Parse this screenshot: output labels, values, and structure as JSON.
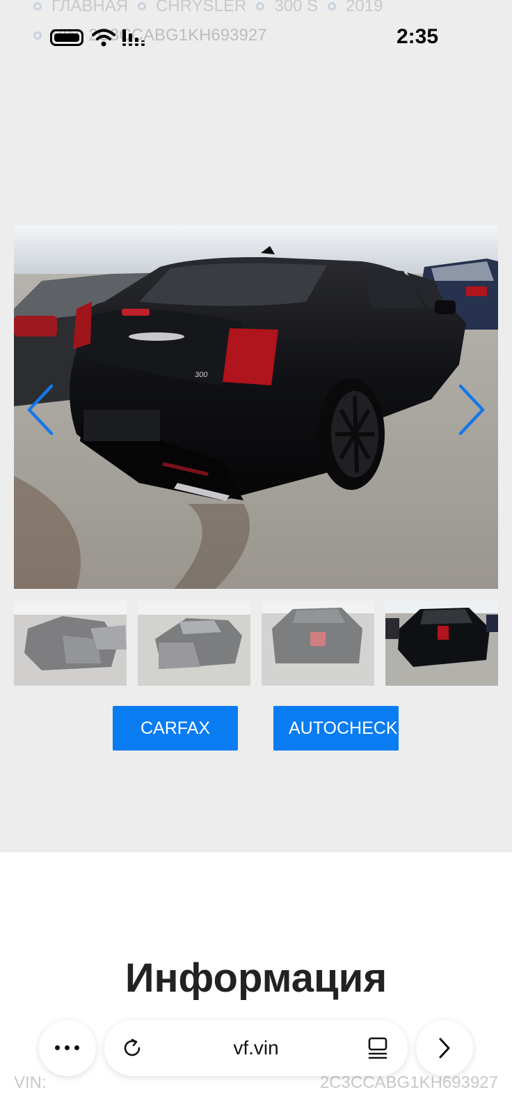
{
  "breadcrumb": {
    "items": [
      "ГЛАВНАЯ",
      "CHRYSLER",
      "300 S",
      "2019"
    ],
    "vin": "VIN: 2C3CCABG1KH693927"
  },
  "status_bar": {
    "time": "2:35"
  },
  "gallery": {
    "main_image": "black Chrysler 300 S rear three-quarter view at salvage yard",
    "thumbnails": [
      "damaged front view",
      "crashed front close-up",
      "rear view",
      "rear three-quarter view"
    ]
  },
  "buttons": {
    "carfax": "CARFAX",
    "autocheck": "AUTOCHECK"
  },
  "info": {
    "title": "Информация",
    "vin_label": "VIN:",
    "vin_value": "2C3CCABG1KH693927"
  },
  "browser": {
    "url": "vf.vin"
  },
  "colors": {
    "accent": "#0a7cf2",
    "page_bg": "#ededed",
    "section_bg": "#ffffff",
    "car": "#0d0d10",
    "tail_light": "#b0141c"
  },
  "icons": [
    "battery-icon",
    "wifi-icon",
    "signal-icon",
    "chevron-left-icon",
    "chevron-right-icon",
    "more-icon",
    "reload-icon",
    "tabs-icon",
    "forward-icon"
  ]
}
